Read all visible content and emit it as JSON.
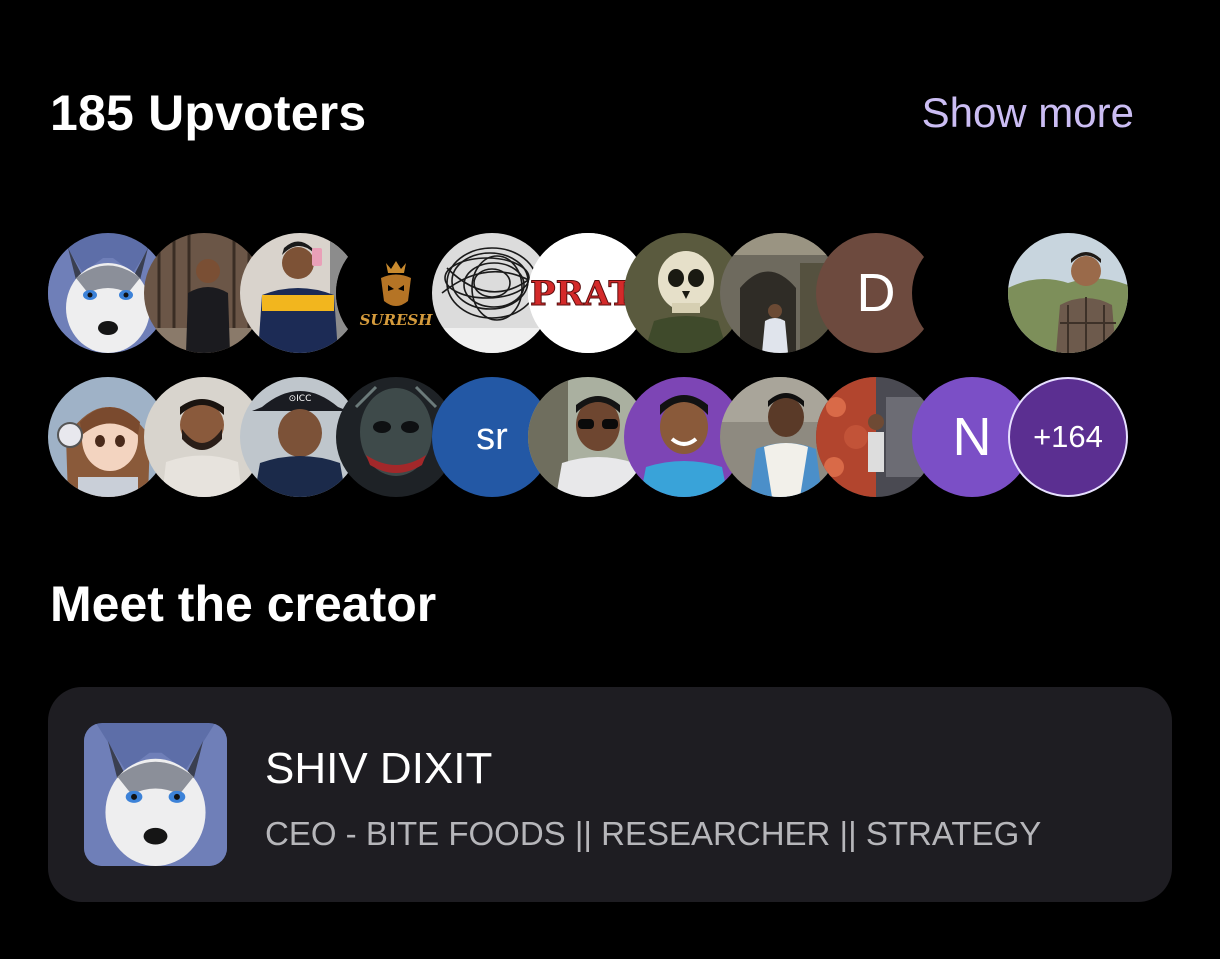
{
  "upvoters": {
    "title": "185 Upvoters",
    "show_more_label": "Show more",
    "row1": [
      {
        "kind": "photo",
        "icon": "husky-dog-avatar"
      },
      {
        "kind": "photo",
        "icon": "man-black-shirt-avatar"
      },
      {
        "kind": "photo",
        "icon": "man-striped-shirt-selfie-avatar"
      },
      {
        "kind": "logo",
        "icon": "lion-logo-avatar",
        "text": "SURESH"
      },
      {
        "kind": "photo",
        "icon": "scribble-sketch-avatar"
      },
      {
        "kind": "logo",
        "icon": "prati-text-avatar",
        "text": "PRATI"
      },
      {
        "kind": "photo",
        "icon": "skull-illustration-avatar"
      },
      {
        "kind": "photo",
        "icon": "stone-arch-man-avatar"
      },
      {
        "kind": "letter",
        "letter": "D",
        "color": "#6d4a3e"
      },
      {
        "kind": "blank"
      },
      {
        "kind": "photo",
        "icon": "man-plaid-shirt-outdoor-avatar"
      }
    ],
    "row2": [
      {
        "kind": "photo",
        "icon": "anime-girl-headphones-avatar"
      },
      {
        "kind": "photo",
        "icon": "bearded-man-avatar"
      },
      {
        "kind": "photo",
        "icon": "icc-cap-man-avatar"
      },
      {
        "kind": "photo",
        "icon": "joker-face-avatar"
      },
      {
        "kind": "letter",
        "letter": "sr",
        "color": "#2358a5"
      },
      {
        "kind": "photo",
        "icon": "man-sunglasses-avatar"
      },
      {
        "kind": "photo",
        "icon": "smiling-man-purple-bg-avatar"
      },
      {
        "kind": "photo",
        "icon": "man-white-scarf-avatar"
      },
      {
        "kind": "photo",
        "icon": "red-room-wall-avatar"
      },
      {
        "kind": "letter",
        "letter": "N",
        "color": "#7b4fc6"
      },
      {
        "kind": "more",
        "label": "+164",
        "color": "#5b2f91"
      }
    ]
  },
  "creator": {
    "heading": "Meet the creator",
    "name": "SHIV DIXIT",
    "role": "CEO - BITE FOODS || RESEARCHER || STRATEGY",
    "avatar_icon": "husky-dog-avatar"
  },
  "colors": {
    "background": "#000000",
    "accent": "#cbbdf3",
    "card": "#1e1d22",
    "muted_text": "#b6b6ba"
  }
}
